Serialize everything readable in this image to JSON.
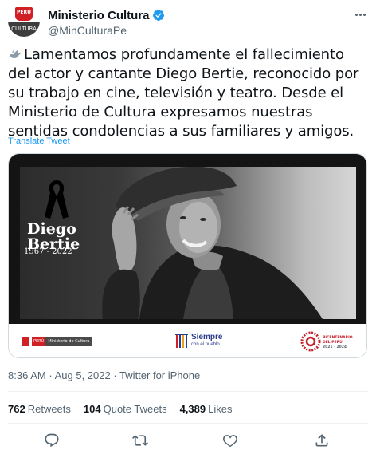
{
  "account": {
    "display_name": "Ministerio Cultura",
    "handle": "@MinCulturaPe",
    "avatar_top_text": "PERÚ",
    "avatar_bottom_text": "CULTURA",
    "verified_icon": "verified-badge-icon"
  },
  "tweet": {
    "text": "Lamentamos profundamente el fallecimiento del actor y cantante Diego Bertie, reconocido por su trabajo en cine, televisión y teatro. Desde el Ministerio de Cultura expresamos nuestras sentidas condolencias a sus familiares y amigos.",
    "translate_label": "Translate Tweet"
  },
  "media": {
    "person_name_line1": "Diego",
    "person_name_line2": "Bertie",
    "person_years": "1967 - 2022",
    "logo_peru_short": "PERÚ",
    "logo_ministry": "Ministerio de Cultura",
    "logo_siempre": "Siempre",
    "logo_siempre_sub": "con el pueblo",
    "logo_bicentenario_line1": "BICENTENARIO",
    "logo_bicentenario_line2": "DEL PERÚ",
    "logo_bicentenario_line3": "2021 - 2024"
  },
  "meta": {
    "time": "8:36 AM",
    "separator": "·",
    "date": "Aug 5, 2022",
    "source": "Twitter for iPhone"
  },
  "stats": {
    "retweets_count": "762",
    "retweets_label": "Retweets",
    "quotes_count": "104",
    "quotes_label": "Quote Tweets",
    "likes_count": "4,389",
    "likes_label": "Likes"
  },
  "actions": [
    "reply-icon",
    "retweet-icon",
    "like-icon",
    "share-icon"
  ],
  "colors": {
    "link_blue": "#1d9bf0",
    "secondary_text": "#536471",
    "primary_text": "#0f1419",
    "peru_red": "#d11f26"
  }
}
